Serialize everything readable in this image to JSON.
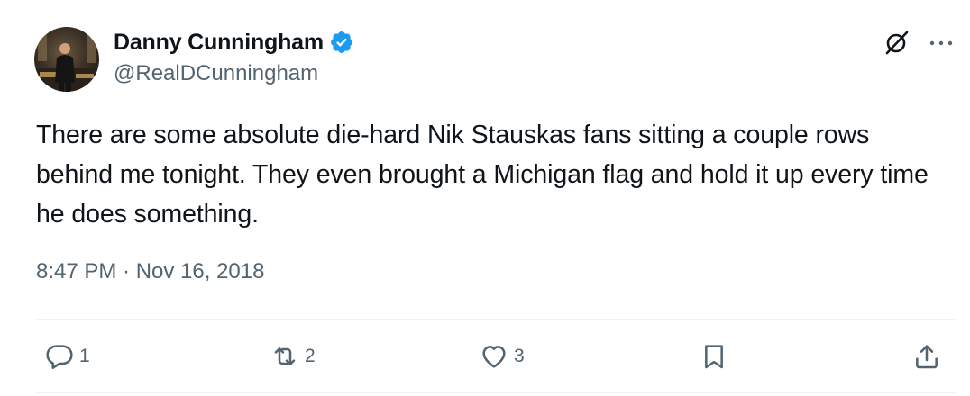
{
  "author": {
    "display_name": "Danny Cunningham",
    "handle": "@RealDCunningham",
    "verified": true,
    "verified_color": "#1d9bf0"
  },
  "tweet": {
    "text": "There are some absolute die-hard Nik Stauskas fans sitting a couple rows behind me tonight. They even brought a Michigan flag and hold it up every time he does something.",
    "timestamp": "8:47 PM · Nov 16, 2018"
  },
  "actions": {
    "reply_count": "1",
    "repost_count": "2",
    "like_count": "3",
    "icons": [
      "reply-icon",
      "repost-icon",
      "like-icon",
      "bookmark-icon",
      "share-icon"
    ]
  },
  "header_icons": [
    "grok-icon",
    "more-icon"
  ],
  "colors": {
    "text_primary": "#0f1419",
    "text_secondary": "#536471",
    "divider": "#eff3f4"
  }
}
